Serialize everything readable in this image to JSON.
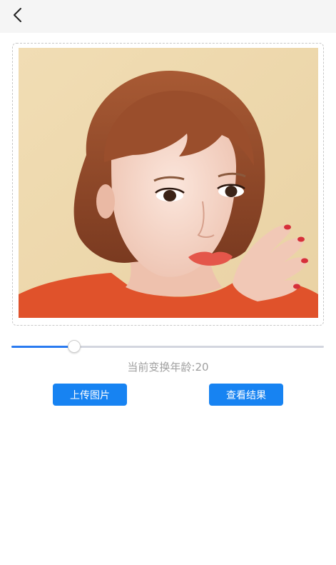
{
  "header": {
    "back_icon": "chevron-left-icon"
  },
  "photo": {
    "icon": "portrait-photo"
  },
  "age_slider": {
    "value": 20,
    "fraction": 0.2
  },
  "age_readout": {
    "label": "当前变换年龄:",
    "value": "20"
  },
  "actions": {
    "upload_label": "上传图片",
    "result_label": "查看结果"
  },
  "colors": {
    "accent": "#1783f2",
    "slider_fill": "#2a7bf0",
    "slider_track": "#d3d6df",
    "readout_text": "#a0a0a0",
    "topbar_bg": "#f5f5f5"
  }
}
